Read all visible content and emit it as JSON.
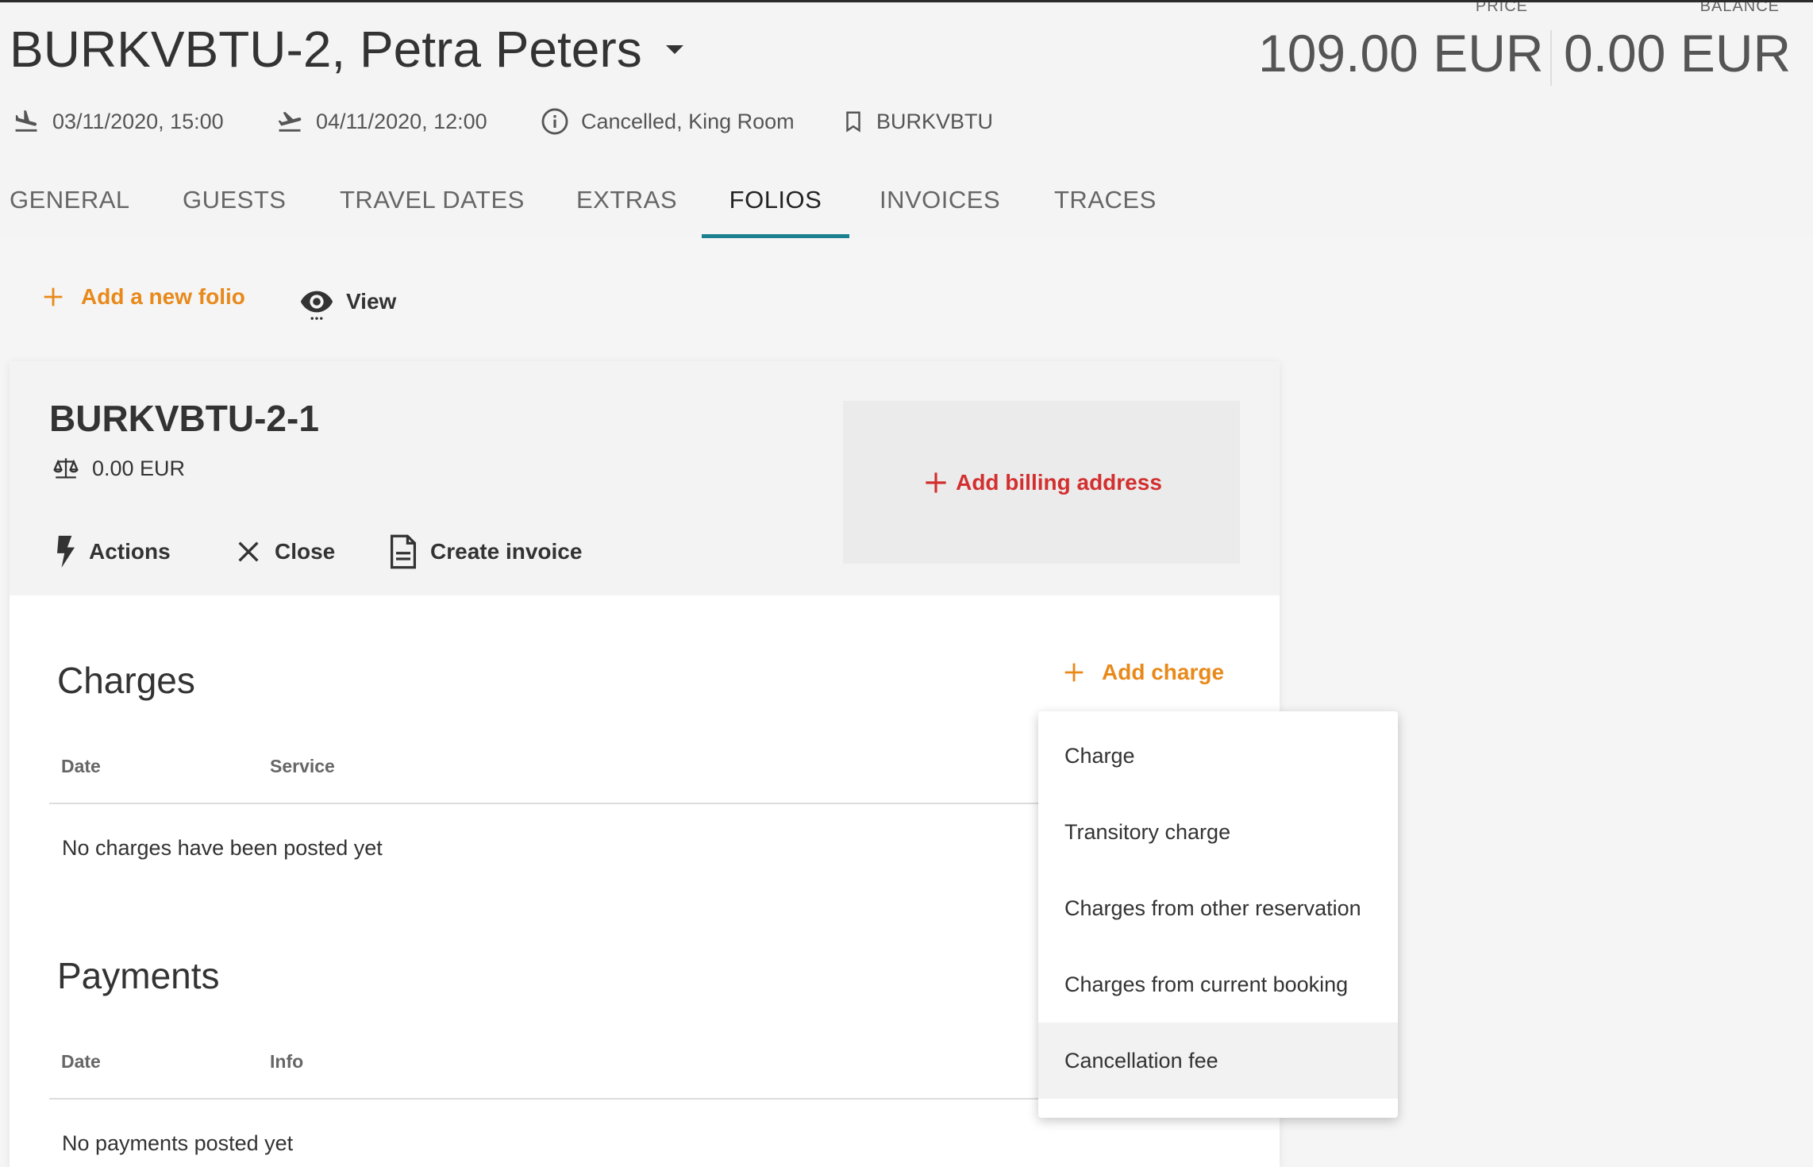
{
  "header": {
    "title": "BURKVBTU-2, Petra Peters",
    "price_label": "PRICE",
    "price_value": "109.00 EUR",
    "balance_label": "BALANCE",
    "balance_value": "0.00 EUR",
    "arrival": "03/11/2020, 15:00",
    "departure": "04/11/2020, 12:00",
    "status": "Cancelled, King Room",
    "booking_id": "BURKVBTU"
  },
  "tabs": [
    {
      "label": "GENERAL"
    },
    {
      "label": "GUESTS"
    },
    {
      "label": "TRAVEL DATES"
    },
    {
      "label": "EXTRAS"
    },
    {
      "label": "FOLIOS"
    },
    {
      "label": "INVOICES"
    },
    {
      "label": "TRACES"
    }
  ],
  "active_tab": "FOLIOS",
  "toolbar": {
    "add_folio_label": "Add a new folio",
    "view_label": "View"
  },
  "folio": {
    "name": "BURKVBTU-2-1",
    "balance": "0.00 EUR",
    "actions_label": "Actions",
    "close_label": "Close",
    "create_invoice_label": "Create invoice",
    "add_billing_label": "Add billing address"
  },
  "charges": {
    "title": "Charges",
    "add_label": "Add charge",
    "col_date": "Date",
    "col_service": "Service",
    "empty": "No charges have been posted yet"
  },
  "payments": {
    "title": "Payments",
    "col_date": "Date",
    "col_info": "Info",
    "empty": "No payments posted yet"
  },
  "charge_menu": {
    "items": [
      {
        "label": "Charge"
      },
      {
        "label": "Transitory charge"
      },
      {
        "label": "Charges from other reservation"
      },
      {
        "label": "Charges from current booking"
      },
      {
        "label": "Cancellation fee"
      }
    ],
    "hovered": "Cancellation fee"
  },
  "colors": {
    "accent_orange": "#e8891a",
    "accent_red": "#d32f2f",
    "tab_indicator": "#1a7f8e"
  }
}
